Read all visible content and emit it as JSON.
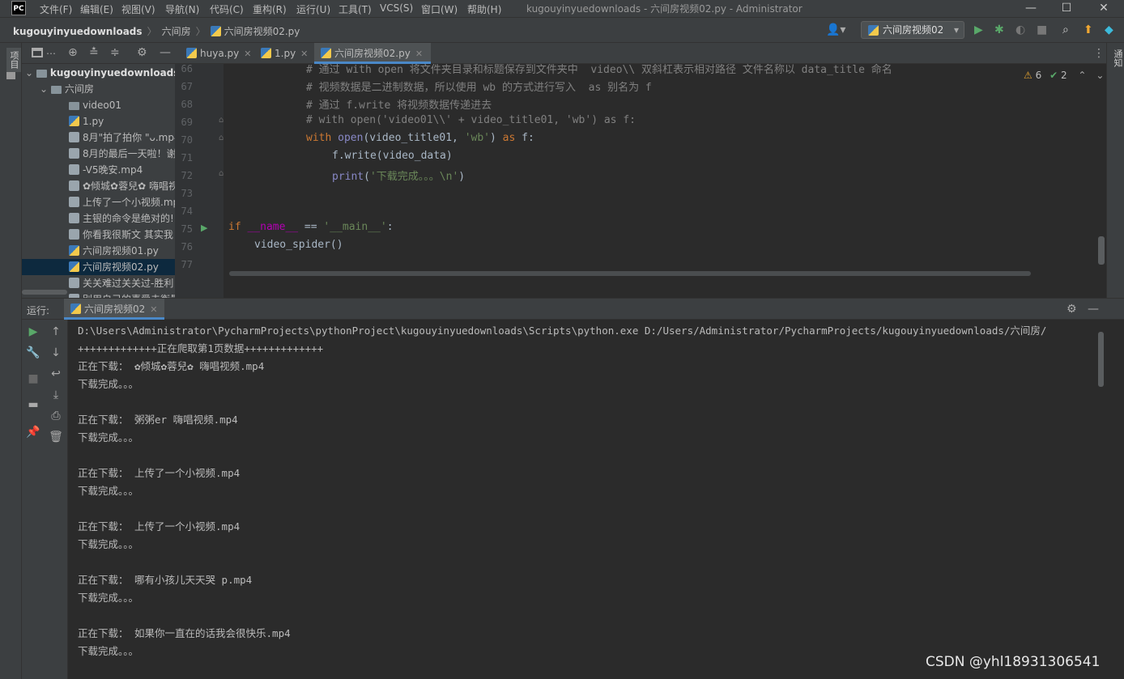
{
  "window": {
    "title": "kugouyinyuedownloads - 六间房视频02.py - Administrator",
    "logo": "PC",
    "controls": [
      "—",
      "☐",
      "✕"
    ]
  },
  "menu": [
    "文件(F)",
    "编辑(E)",
    "视图(V)",
    "导航(N)",
    "代码(C)",
    "重构(R)",
    "运行(U)",
    "工具(T)",
    "VCS(S)",
    "窗口(W)",
    "帮助(H)"
  ],
  "breadcrumb": {
    "project": "kugouyinyuedownloads",
    "folder": "六间房",
    "file": "六间房视频02.py"
  },
  "toolbar": {
    "run_config": "六间房视频02"
  },
  "side_tabs": {
    "left_project": "项目",
    "left_structure": "结构",
    "right": "通知"
  },
  "project_tree": [
    {
      "label": "kugouyinyuedownloads",
      "type": "root"
    },
    {
      "label": "六间房",
      "type": "dir"
    },
    {
      "label": "video01",
      "type": "dir"
    },
    {
      "label": "1.py",
      "type": "py"
    },
    {
      "label": "8月\"拍了拍你 \"ᴗ.mp4",
      "type": "file"
    },
    {
      "label": "8月的最后一天啦！谢",
      "type": "file"
    },
    {
      "label": "-V5晚安.mp4",
      "type": "file"
    },
    {
      "label": "✿倾城✿蓉兒✿ 嗨唱视",
      "type": "file"
    },
    {
      "label": "上传了一个小视频.mp",
      "type": "file"
    },
    {
      "label": "主银的命令是绝对的!",
      "type": "file"
    },
    {
      "label": "你看我很斯文 其实我",
      "type": "file"
    },
    {
      "label": "六间房视频01.py",
      "type": "py"
    },
    {
      "label": "六间房视频02.py",
      "type": "py",
      "selected": true
    },
    {
      "label": "关关难过关关过-胜利",
      "type": "file"
    },
    {
      "label": "别用自己的喜爱去衡量",
      "type": "file"
    }
  ],
  "editor_tabs": [
    {
      "label": "huya.py"
    },
    {
      "label": "1.py"
    },
    {
      "label": "六间房视频02.py",
      "active": true
    }
  ],
  "inspections": {
    "warnings": "6",
    "ok": "2"
  },
  "code_lines": [
    {
      "n": "66",
      "indent": 3,
      "tokens": [
        {
          "c": "cm",
          "t": "# 通过 with open 将文件夹目录和标题保存到文件夹中  video\\\\ 双斜杠表示相对路径 文件名称以 data_title 命名"
        }
      ]
    },
    {
      "n": "67",
      "indent": 3,
      "tokens": [
        {
          "c": "cm",
          "t": "# 视频数据是二进制数据，所以使用 wb 的方式进行写入  as 别名为 f"
        }
      ]
    },
    {
      "n": "68",
      "indent": 3,
      "tokens": [
        {
          "c": "cm",
          "t": "# 通过 f.write 将视频数据传递进去"
        }
      ]
    },
    {
      "n": "69",
      "indent": 3,
      "tokens": [
        {
          "c": "cm",
          "t": "# with open('video01\\\\' + video_title01, 'wb') as f:"
        }
      ]
    },
    {
      "n": "70",
      "indent": 3,
      "tokens": [
        {
          "c": "kw",
          "t": "with "
        },
        {
          "c": "bi",
          "t": "open"
        },
        {
          "c": "",
          "t": "(video_title01, "
        },
        {
          "c": "st",
          "t": "'wb'"
        },
        {
          "c": "",
          "t": ") "
        },
        {
          "c": "kw",
          "t": "as "
        },
        {
          "c": "",
          "t": "f:"
        }
      ]
    },
    {
      "n": "71",
      "indent": 4,
      "tokens": [
        {
          "c": "",
          "t": "f.write(video_data)"
        }
      ]
    },
    {
      "n": "72",
      "indent": 4,
      "tokens": [
        {
          "c": "bi",
          "t": "print"
        },
        {
          "c": "",
          "t": "("
        },
        {
          "c": "st",
          "t": "'下载完成。。。\\n'"
        },
        {
          "c": "",
          "t": ")"
        }
      ]
    },
    {
      "n": "73",
      "indent": 0,
      "tokens": []
    },
    {
      "n": "74",
      "indent": 0,
      "tokens": []
    },
    {
      "n": "75",
      "indent": 0,
      "tokens": [
        {
          "c": "kw",
          "t": "if "
        },
        {
          "c": "dn",
          "t": "__name__"
        },
        {
          "c": "",
          "t": " == "
        },
        {
          "c": "st",
          "t": "'__main__'"
        },
        {
          "c": "",
          "t": ":"
        }
      ]
    },
    {
      "n": "76",
      "indent": 1,
      "tokens": [
        {
          "c": "",
          "t": "video_spider()"
        }
      ]
    },
    {
      "n": "77",
      "indent": 0,
      "tokens": []
    }
  ],
  "run_panel": {
    "label": "运行:",
    "tab": "六间房视频02",
    "output": [
      "D:\\Users\\Administrator\\PycharmProjects\\pythonProject\\kugouyinyuedownloads\\Scripts\\python.exe D:/Users/Administrator/PycharmProjects/kugouyinyuedownloads/六间房/",
      "+++++++++++++正在爬取第1页数据+++++++++++++",
      "正在下载： ✿倾城✿蓉兒✿ 嗨唱视频.mp4",
      "下载完成。。。",
      "",
      "正在下载： 粥粥er 嗨唱视频.mp4",
      "下载完成。。。",
      "",
      "正在下载： 上传了一个小视频.mp4",
      "下载完成。。。",
      "",
      "正在下载： 上传了一个小视频.mp4",
      "下载完成。。。",
      "",
      "正在下载： 哪有小孩儿天天哭 p.mp4",
      "下载完成。。。",
      "",
      "正在下载： 如果你一直在的话我会很快乐.mp4",
      "下载完成。。。"
    ]
  },
  "watermark": "CSDN @yhl18931306541"
}
